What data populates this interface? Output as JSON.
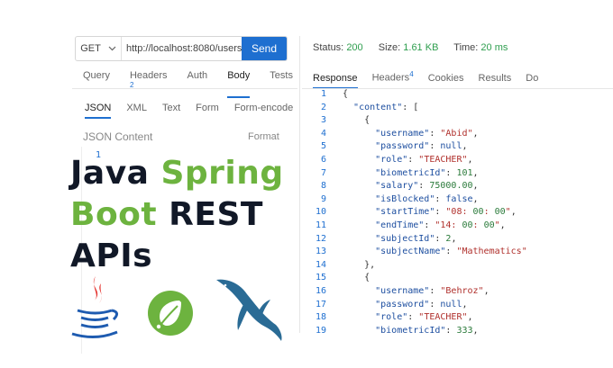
{
  "request": {
    "method": "GET",
    "url": "http://localhost:8080/users",
    "send_label": "Send"
  },
  "left_tabs": [
    {
      "label": "Query"
    },
    {
      "label": "Headers",
      "badge": "2"
    },
    {
      "label": "Auth"
    },
    {
      "label": "Body",
      "active": true
    },
    {
      "label": "Tests"
    }
  ],
  "body_tabs": [
    {
      "label": "JSON",
      "active": true
    },
    {
      "label": "XML"
    },
    {
      "label": "Text"
    },
    {
      "label": "Form"
    },
    {
      "label": "Form-encode"
    }
  ],
  "editor": {
    "title": "JSON Content",
    "format_label": "Format",
    "line_number": "1"
  },
  "headline": {
    "line1_a": "Java ",
    "line1_b": "Spring",
    "line2_a": "Boot",
    "line2_b": " REST",
    "line3": "APIs"
  },
  "status": {
    "status_label": "Status:",
    "status_value": "200",
    "size_label": "Size:",
    "size_value": "1.61 KB",
    "time_label": "Time:",
    "time_value": "20 ms"
  },
  "right_tabs": [
    {
      "label": "Response",
      "active": true
    },
    {
      "label": "Headers",
      "badge": "4"
    },
    {
      "label": "Cookies"
    },
    {
      "label": "Results"
    },
    {
      "label": "Do"
    }
  ],
  "response_lines": [
    {
      "n": "1",
      "text": "{"
    },
    {
      "n": "2",
      "text": "  \"content\": ["
    },
    {
      "n": "3",
      "text": "    {"
    },
    {
      "n": "4",
      "text": "      \"username\": \"Abid\","
    },
    {
      "n": "5",
      "text": "      \"password\": null,"
    },
    {
      "n": "6",
      "text": "      \"role\": \"TEACHER\","
    },
    {
      "n": "7",
      "text": "      \"biometricId\": 101,"
    },
    {
      "n": "8",
      "text": "      \"salary\": 75000.00,"
    },
    {
      "n": "9",
      "text": "      \"isBlocked\": false,"
    },
    {
      "n": "10",
      "text": "      \"startTime\": \"08:00:00\","
    },
    {
      "n": "11",
      "text": "      \"endTime\": \"14:00:00\","
    },
    {
      "n": "12",
      "text": "      \"subjectId\": 2,"
    },
    {
      "n": "13",
      "text": "      \"subjectName\": \"Mathematics\""
    },
    {
      "n": "14",
      "text": "    },"
    },
    {
      "n": "15",
      "text": "    {"
    },
    {
      "n": "16",
      "text": "      \"username\": \"Behroz\","
    },
    {
      "n": "17",
      "text": "      \"password\": null,"
    },
    {
      "n": "18",
      "text": "      \"role\": \"TEACHER\","
    },
    {
      "n": "19",
      "text": "      \"biometricId\": 333,"
    }
  ],
  "colors": {
    "accent": "#1e6fd0",
    "spring_green": "#6db33f",
    "status_green": "#2e9e4e",
    "headline_dark": "#111827"
  },
  "icons": [
    "chevron-down-icon",
    "java-logo",
    "spring-logo",
    "mysql-dolphin-logo"
  ]
}
